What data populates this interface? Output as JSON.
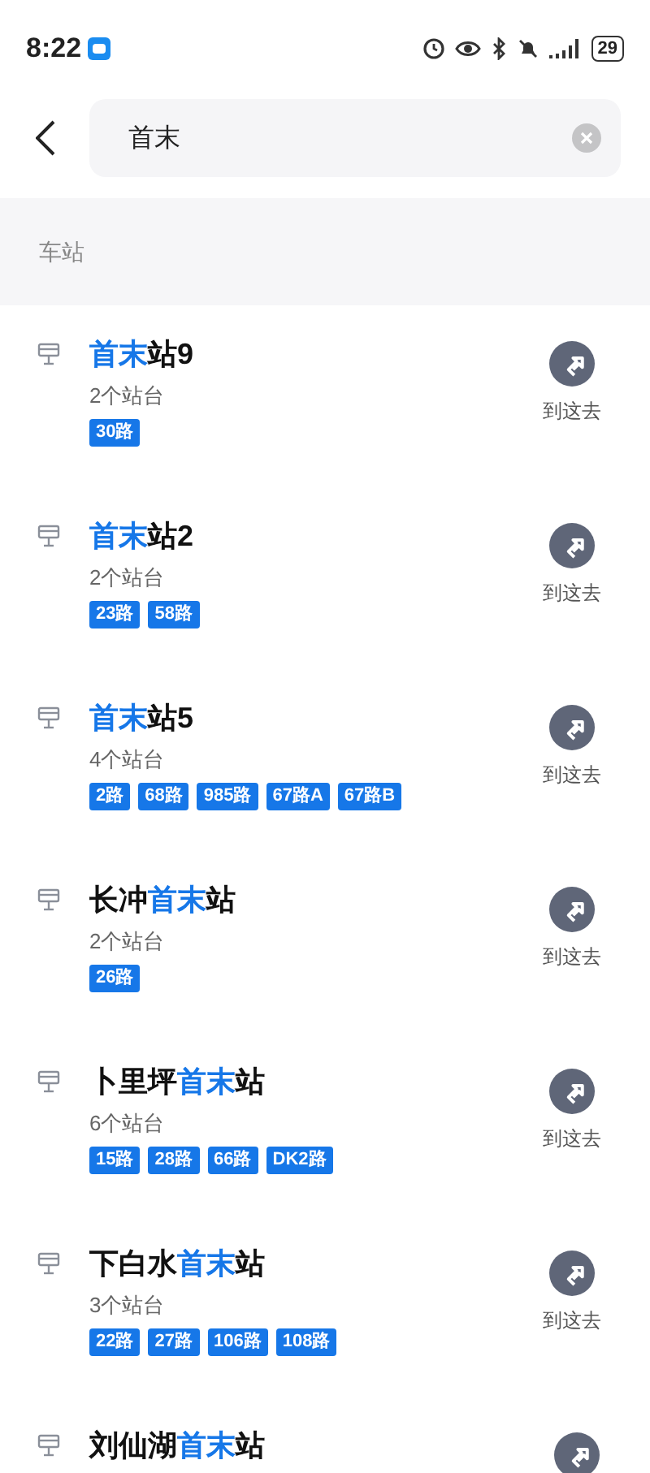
{
  "status_bar": {
    "time": "8:22",
    "battery": "29"
  },
  "search": {
    "value": "首末"
  },
  "section": {
    "title": "车站"
  },
  "stations": [
    {
      "name": [
        {
          "text": "首末",
          "highlight": true
        },
        {
          "text": "站9",
          "highlight": false
        }
      ],
      "platforms": "2个站台",
      "routes": [
        "30路"
      ],
      "action": "到这去"
    },
    {
      "name": [
        {
          "text": "首末",
          "highlight": true
        },
        {
          "text": "站2",
          "highlight": false
        }
      ],
      "platforms": "2个站台",
      "routes": [
        "23路",
        "58路"
      ],
      "action": "到这去"
    },
    {
      "name": [
        {
          "text": "首末",
          "highlight": true
        },
        {
          "text": "站5",
          "highlight": false
        }
      ],
      "platforms": "4个站台",
      "routes": [
        "2路",
        "68路",
        "985路",
        "67路A",
        "67路B"
      ],
      "action": "到这去"
    },
    {
      "name": [
        {
          "text": "长冲",
          "highlight": false
        },
        {
          "text": "首末",
          "highlight": true
        },
        {
          "text": "站",
          "highlight": false
        }
      ],
      "platforms": "2个站台",
      "routes": [
        "26路"
      ],
      "action": "到这去"
    },
    {
      "name": [
        {
          "text": "卜里坪",
          "highlight": false
        },
        {
          "text": "首末",
          "highlight": true
        },
        {
          "text": "站",
          "highlight": false
        }
      ],
      "platforms": "6个站台",
      "routes": [
        "15路",
        "28路",
        "66路",
        "DK2路"
      ],
      "action": "到这去"
    },
    {
      "name": [
        {
          "text": "下白水",
          "highlight": false
        },
        {
          "text": "首末",
          "highlight": true
        },
        {
          "text": "站",
          "highlight": false
        }
      ],
      "platforms": "3个站台",
      "routes": [
        "22路",
        "27路",
        "106路",
        "108路"
      ],
      "action": "到这去"
    },
    {
      "name": [
        {
          "text": "刘仙湖",
          "highlight": false
        },
        {
          "text": "首末",
          "highlight": true
        },
        {
          "text": "站",
          "highlight": false
        }
      ]
    }
  ]
}
